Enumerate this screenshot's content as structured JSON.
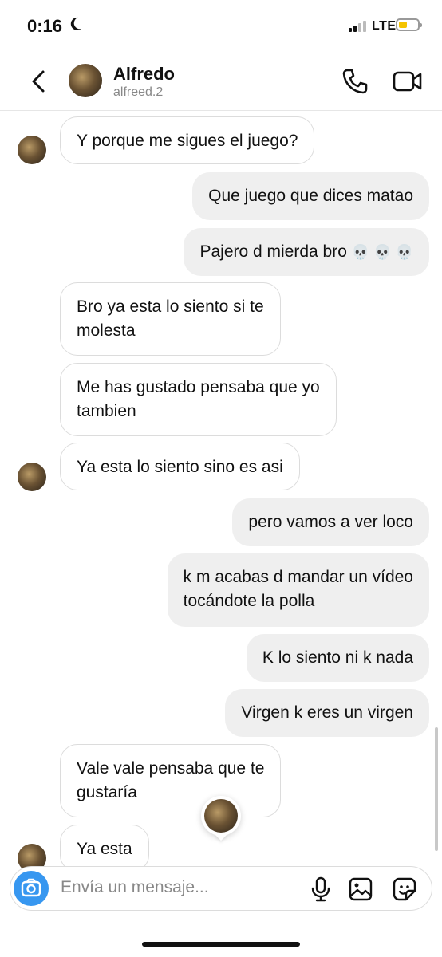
{
  "status": {
    "time": "0:16",
    "network": "LTE",
    "moon_icon": "moon-icon"
  },
  "header": {
    "name": "Alfredo",
    "username": "alfreed.2"
  },
  "messages": [
    {
      "from": "them",
      "line1": "Y porque me sigues el juego?",
      "line2": ""
    },
    {
      "from": "me",
      "line1": "Que juego que dices matao",
      "line2": ""
    },
    {
      "from": "me",
      "line1": "Pajero d mierda bro",
      "emoji": "💀 💀 💀",
      "line2": ""
    },
    {
      "from": "them",
      "line1": "Bro ya esta lo siento si te",
      "line2": "molesta"
    },
    {
      "from": "them",
      "line1": "Me has gustado pensaba que yo",
      "line2": "tambien"
    },
    {
      "from": "them",
      "line1": "Ya esta lo siento sino es asi",
      "line2": ""
    },
    {
      "from": "me",
      "line1": "pero vamos a ver loco",
      "line2": ""
    },
    {
      "from": "me",
      "line1": "k m acabas d mandar un vídeo",
      "line2": "tocándote la polla"
    },
    {
      "from": "me",
      "line1": "K lo siento ni k nada",
      "line2": ""
    },
    {
      "from": "me",
      "line1": "Virgen k eres un virgen",
      "line2": ""
    },
    {
      "from": "them",
      "line1": "Vale vale pensaba que te",
      "line2": "gustaría"
    },
    {
      "from": "them",
      "line1": "Ya esta",
      "line2": ""
    }
  ],
  "composer": {
    "placeholder": "Envía un mensaje..."
  },
  "colors": {
    "accent": "#3797f0",
    "outgoing_bubble": "#efefef",
    "incoming_border": "#dcdcdc"
  }
}
